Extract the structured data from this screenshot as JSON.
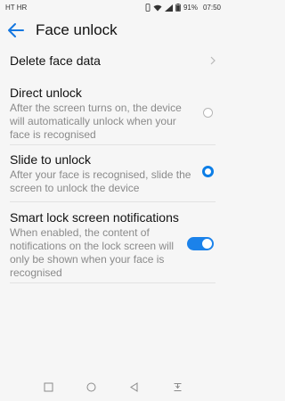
{
  "status_bar": {
    "carrier": "HT HR",
    "battery": "91%",
    "time": "07:50"
  },
  "app_bar": {
    "title": "Face unlock"
  },
  "rows": {
    "delete_face_data": "Delete face data",
    "direct_unlock": {
      "title": "Direct unlock",
      "description": "After the screen turns on, the device will automatically unlock when your face is recognised",
      "selected": false
    },
    "slide_to_unlock": {
      "title": "Slide to unlock",
      "description": "After your face is recognised, slide the screen to unlock the device",
      "selected": true
    },
    "smart_lock": {
      "title": "Smart lock screen notifications",
      "description": "When enabled, the content of notifications on the lock screen will only be shown when your face is recognised",
      "enabled": true
    }
  },
  "colors": {
    "accent": "#0d7ee6",
    "background": "#f6f6f6"
  },
  "icons": [
    "back-arrow-icon",
    "chevron-right-icon",
    "nav-square-icon",
    "nav-circle-icon",
    "nav-triangle-icon",
    "nav-notification-icon"
  ]
}
